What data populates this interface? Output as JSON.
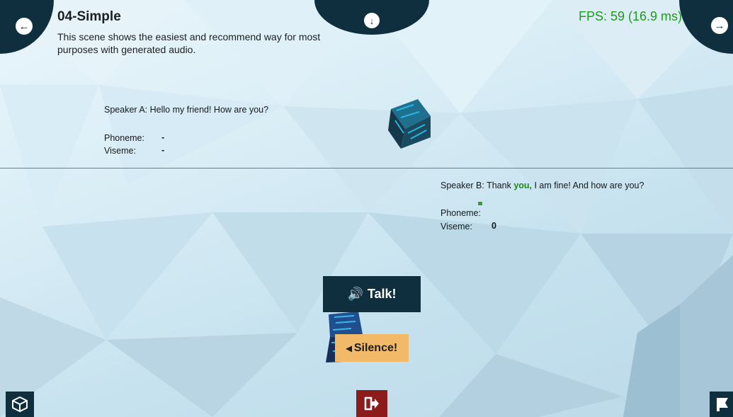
{
  "header": {
    "title": "04-Simple",
    "description": "This scene shows the easiest and recommend way for most purposes with generated audio.",
    "fps_text": "FPS: 59 (16.9 ms)"
  },
  "icons": {
    "prev": "arrow-left-icon",
    "next": "arrow-right-icon",
    "down": "arrow-down-icon",
    "unity": "unity-logo-icon",
    "exit": "exit-icon",
    "br": "flag-icon",
    "talk": "speaker-icon",
    "silence": "speaker-mute-icon"
  },
  "speaker_a": {
    "prefix": "Speaker A: ",
    "text": "Hello my friend! How are you?",
    "phoneme_label": "Phoneme:",
    "phoneme_value": "-",
    "viseme_label": "Viseme:",
    "viseme_value": "-"
  },
  "speaker_b": {
    "prefix": "Speaker B: Thank ",
    "highlight": "you,",
    "rest": " I am fine! And how are you?",
    "phoneme_label": "Phoneme:",
    "phoneme_value": "",
    "viseme_label": "Viseme:",
    "viseme_value": "0"
  },
  "buttons": {
    "talk": "Talk!",
    "silence": "Silence!"
  },
  "colors": {
    "dark": "#0f2f3f",
    "fps": "#1d9a1d",
    "highlight": "#1b8b1b",
    "silence_bg": "#f2b968",
    "exit_bg": "#8c1c1c"
  }
}
